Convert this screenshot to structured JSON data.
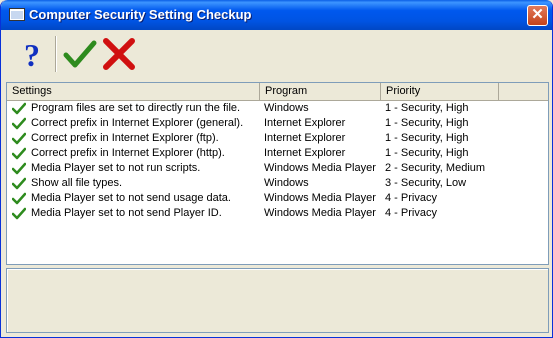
{
  "window": {
    "title": "Computer Security Setting Checkup",
    "close_glyph": "✕"
  },
  "toolbar": {
    "help": "help",
    "accept": "accept",
    "cancel": "cancel"
  },
  "list": {
    "columns": [
      "Settings",
      "Program",
      "Priority"
    ],
    "rows": [
      {
        "setting": "Program files are set to directly run the file.",
        "program": "Windows",
        "priority": "1 - Security, High"
      },
      {
        "setting": "Correct prefix in Internet Explorer (general).",
        "program": "Internet Explorer",
        "priority": "1 - Security, High"
      },
      {
        "setting": "Correct prefix in Internet Explorer (ftp).",
        "program": "Internet Explorer",
        "priority": "1 - Security, High"
      },
      {
        "setting": "Correct prefix in Internet Explorer (http).",
        "program": "Internet Explorer",
        "priority": "1 - Security, High"
      },
      {
        "setting": "Media Player set to not run scripts.",
        "program": "Windows Media Player",
        "priority": "2 - Security, Medium"
      },
      {
        "setting": "Show all file types.",
        "program": "Windows",
        "priority": "3 - Security, Low"
      },
      {
        "setting": "Media Player set to not send usage data.",
        "program": "Windows Media Player",
        "priority": "4 - Privacy"
      },
      {
        "setting": "Media Player set to not send Player ID.",
        "program": "Windows Media Player",
        "priority": "4 - Privacy"
      }
    ]
  },
  "colors": {
    "title_bar": "#0054E3",
    "check": "#2E8B1E",
    "cross": "#D01010",
    "help": "#1030C0"
  }
}
